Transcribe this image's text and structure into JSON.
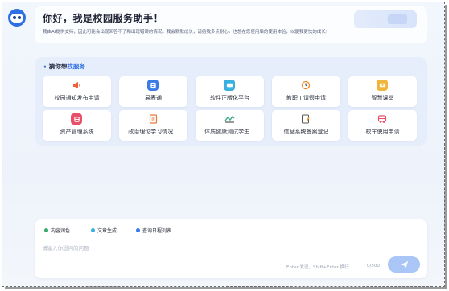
{
  "greeting": {
    "title": "你好，我是校园服务助手！",
    "subtitle": "我由AI提供支持，因此可能会出现回答不了和出现错误的情况。我会默默成长，请给我多点耐心。也想在您使用后的使用体验，以便我更快的成长!"
  },
  "services": {
    "title_prefix": "猜你想",
    "title_accent": "找服务",
    "items": [
      {
        "label": "校园通知发布申请",
        "icon": "megaphone-icon",
        "color": "#f0603a"
      },
      {
        "label": "易表通",
        "icon": "form-icon",
        "color": "#3a7be8"
      },
      {
        "label": "软件正版化平台",
        "icon": "monitor-icon",
        "color": "#3ab0e0"
      },
      {
        "label": "教职工请假申请",
        "icon": "clock-icon",
        "color": "#f08a24"
      },
      {
        "label": "智慧课堂",
        "icon": "classroom-icon",
        "color": "#f2b53a"
      },
      {
        "label": "资产管理系统",
        "icon": "asset-icon",
        "color": "#e8506a"
      },
      {
        "label": "政治理论学习情况...",
        "icon": "document-icon",
        "color": "#e87a3a"
      },
      {
        "label": "体质健康测试学生...",
        "icon": "fitness-icon",
        "color": "#3aaa8a"
      },
      {
        "label": "信息系统备案登记",
        "icon": "register-icon",
        "color": "#e89a3a"
      },
      {
        "label": "校车使用申请",
        "icon": "bus-icon",
        "color": "#e8506a"
      }
    ]
  },
  "composer": {
    "chips": [
      {
        "label": "内容润色",
        "color": "#3aaa6a"
      },
      {
        "label": "文章生成",
        "color": "#3ab0e0"
      },
      {
        "label": "查询日程列表",
        "color": "#3a7be8"
      }
    ],
    "placeholder": "请输入你想问的问题",
    "hint": "Enter 发送，Shift+Enter 换行",
    "counter": "0/500"
  }
}
